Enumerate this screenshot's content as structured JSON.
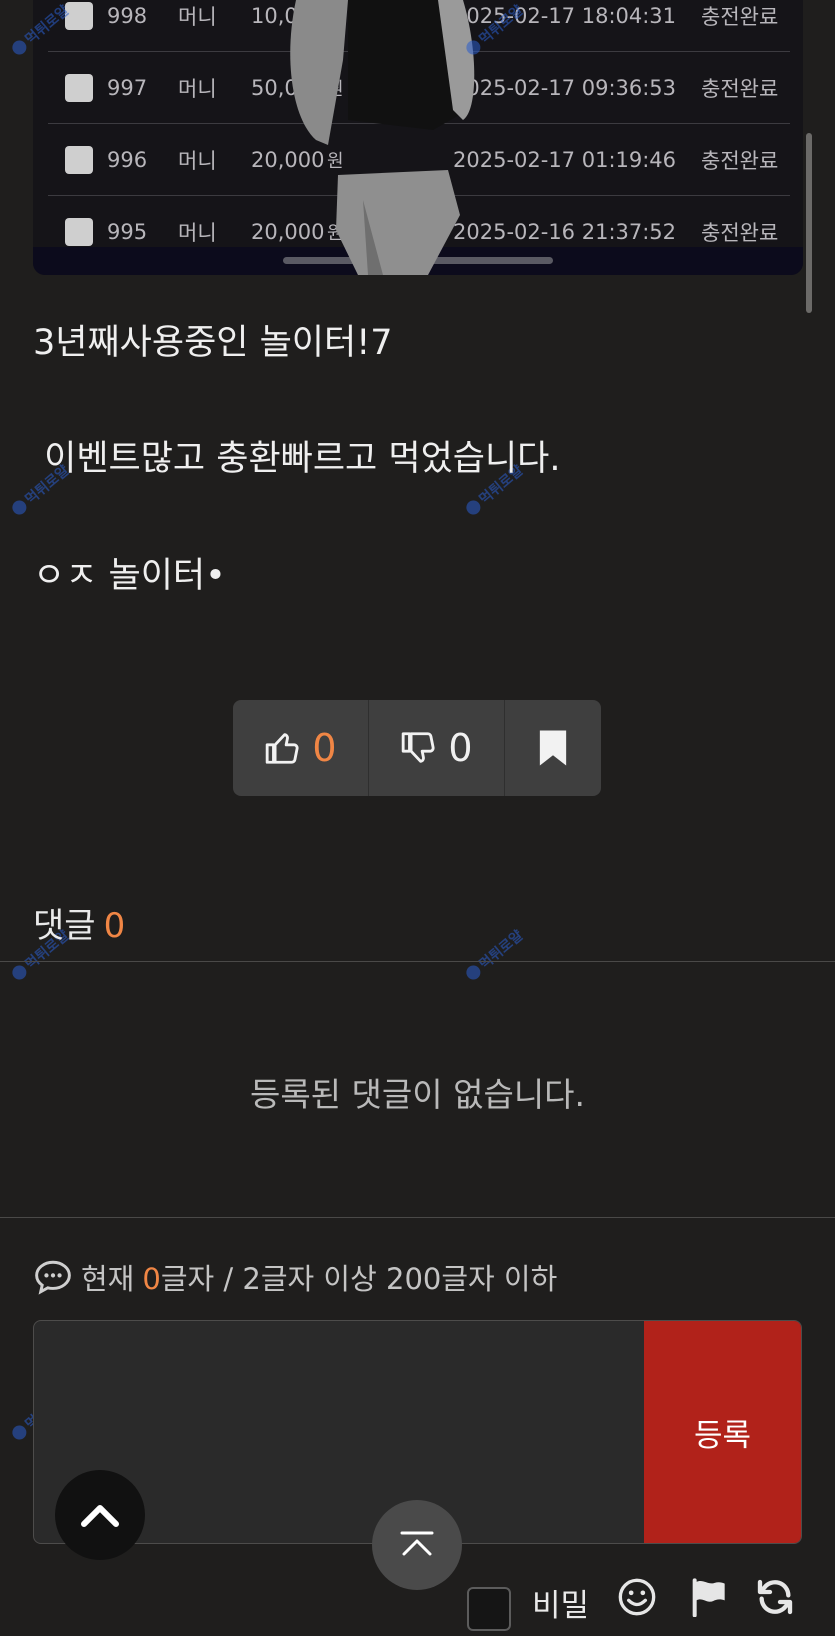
{
  "screenshot_table": {
    "rows": [
      {
        "no": "998",
        "type": "머니",
        "amount": "10,000",
        "unit": "원",
        "date": "2025-02-17 18:04:31",
        "status": "충전완료"
      },
      {
        "no": "997",
        "type": "머니",
        "amount": "50,0",
        "unit": "원",
        "date": "2025-02-17 09:36:53",
        "status": "충전완료"
      },
      {
        "no": "996",
        "type": "머니",
        "amount": "20,000",
        "unit": "원",
        "date": "2025-02-17 01:19:46",
        "status": "충전완료"
      },
      {
        "no": "995",
        "type": "머니",
        "amount": "20,000",
        "unit": "원",
        "date": "2025-02-16 21:37:52",
        "status": "충전완료"
      }
    ]
  },
  "watermark": "먹튀로얄",
  "post": {
    "line1": "3년째사용중인 놀이터!7",
    "line2": " 이벤트많고 충환빠르고 먹었습니다.",
    "line3": "ㅇㅈ 놀이터•"
  },
  "vote": {
    "like_icon": "thumbs-up-icon",
    "like_count": "0",
    "dislike_icon": "thumbs-down-icon",
    "dislike_count": "0",
    "bookmark_icon": "bookmark-icon",
    "like_color": "#f08645"
  },
  "comments": {
    "label": "댓글",
    "count": "0",
    "empty_message": "등록된 댓글이 없습니다."
  },
  "comment_form": {
    "icon": "chat-bubble-icon",
    "prefix": "현재",
    "current": "0",
    "suffix": "글자 / 2글자 이상 200글자 이하",
    "placeholder": "",
    "submit_label": "등록",
    "secret_label": "비밀",
    "submit_color": "#b1221a"
  },
  "floating": {
    "up_icon": "chevron-up-icon",
    "top_icon": "scroll-to-top-icon"
  },
  "tools": [
    "emoji-icon",
    "flag-icon",
    "refresh-icon"
  ]
}
